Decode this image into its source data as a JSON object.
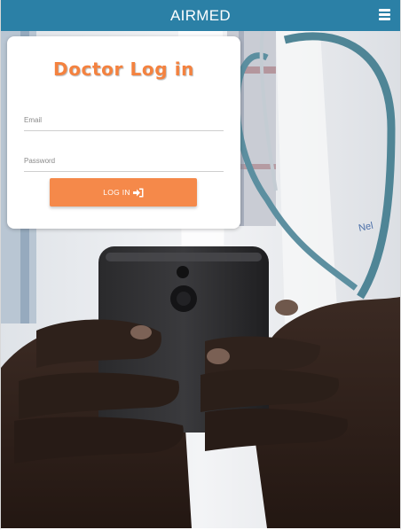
{
  "header": {
    "title": "AIRMED",
    "menu_icon": "hamburger-menu-icon"
  },
  "background": {
    "description_icon": "doctor-holding-phone-photo"
  },
  "login_card": {
    "title": "Doctor Log in",
    "email": {
      "placeholder": "Email",
      "value": ""
    },
    "password": {
      "placeholder": "Password",
      "value": ""
    },
    "login_button": {
      "label": "LOG IN",
      "icon": "sign-in-icon"
    }
  },
  "colors": {
    "header_bg": "#2b80a6",
    "accent": "#f4823f",
    "button_bg": "#f5894a"
  }
}
